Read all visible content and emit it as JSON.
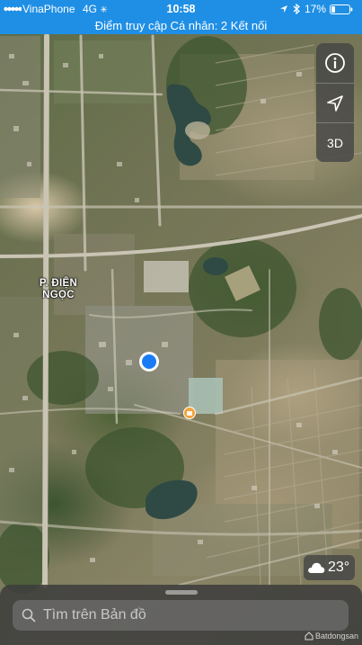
{
  "status_bar": {
    "carrier": "VinaPhone",
    "network": "4G",
    "time": "10:58",
    "battery": "17%"
  },
  "hotspot_banner": "Điểm truy cập Cá nhân: 2 Kết nối",
  "map_controls": {
    "info_icon": "info-icon",
    "locate_icon": "location-arrow-icon",
    "view_3d_label": "3D"
  },
  "map": {
    "place_label_line1": "P. ĐIỆN",
    "place_label_line2": "NGỌC",
    "user_location_color": "#1a7cf5",
    "poi_pin_color": "#f2a33a"
  },
  "weather": {
    "icon": "cloud-icon",
    "temperature": "23°"
  },
  "search": {
    "placeholder": "Tìm trên Bản đồ",
    "icon": "search-icon"
  },
  "watermark": "Batdongsan"
}
